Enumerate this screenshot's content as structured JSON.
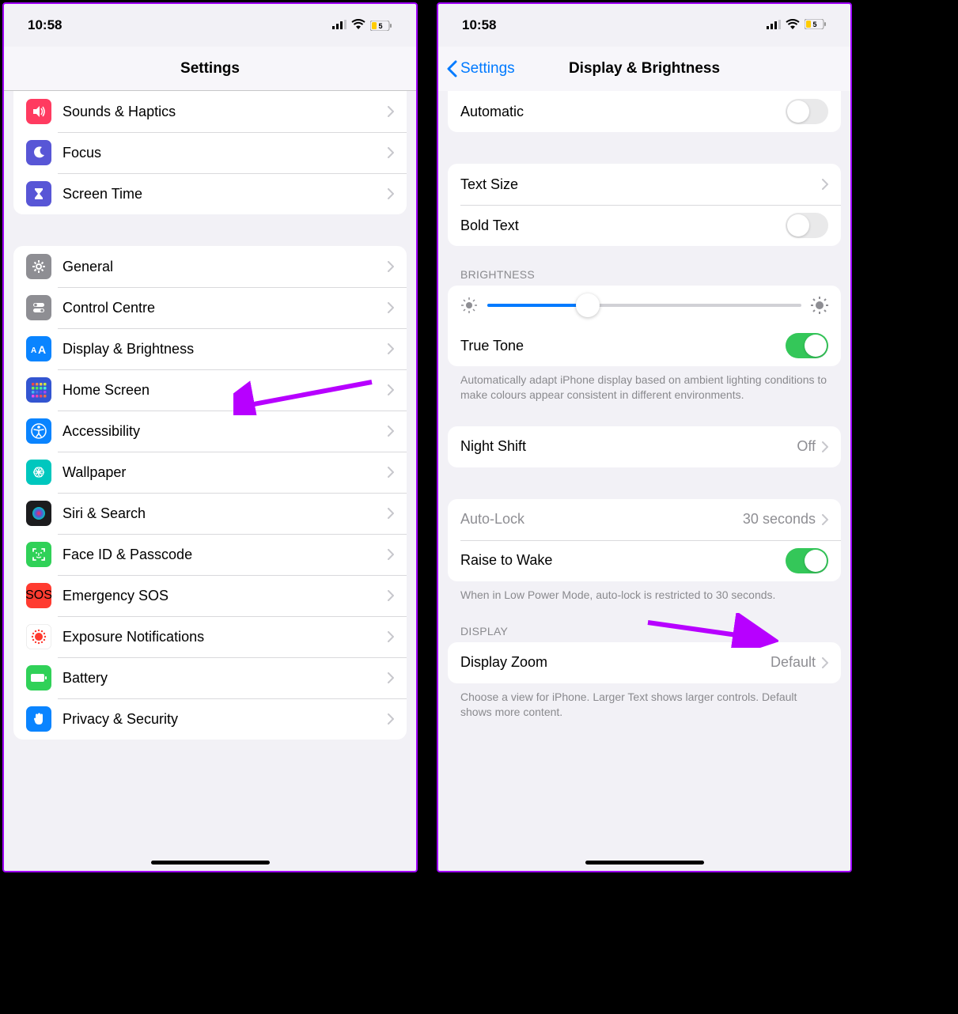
{
  "status": {
    "time": "10:58",
    "battery": "5"
  },
  "left": {
    "title": "Settings",
    "group1": [
      {
        "label": "Sounds & Haptics",
        "icon": "sound-icon",
        "bg": "#ff3b60"
      },
      {
        "label": "Focus",
        "icon": "moon-icon",
        "bg": "#5856d6"
      },
      {
        "label": "Screen Time",
        "icon": "hourglass-icon",
        "bg": "#5856d6"
      }
    ],
    "group2": [
      {
        "label": "General",
        "icon": "gear-icon",
        "bg": "#8e8e93"
      },
      {
        "label": "Control Centre",
        "icon": "toggles-icon",
        "bg": "#8e8e93"
      },
      {
        "label": "Display & Brightness",
        "icon": "aa-icon",
        "bg": "#0a84ff"
      },
      {
        "label": "Home Screen",
        "icon": "grid-icon",
        "bg": "#3355d1"
      },
      {
        "label": "Accessibility",
        "icon": "accessibility-icon",
        "bg": "#0a84ff"
      },
      {
        "label": "Wallpaper",
        "icon": "wallpaper-icon",
        "bg": "#00c7be"
      },
      {
        "label": "Siri & Search",
        "icon": "siri-icon",
        "bg": "#1c1c1e"
      },
      {
        "label": "Face ID & Passcode",
        "icon": "faceid-icon",
        "bg": "#30d158"
      },
      {
        "label": "Emergency SOS",
        "icon": "sos-icon",
        "bg": "#ff3b30"
      },
      {
        "label": "Exposure Notifications",
        "icon": "exposure-icon",
        "bg": "#ffffff"
      },
      {
        "label": "Battery",
        "icon": "battery-icon",
        "bg": "#30d158"
      },
      {
        "label": "Privacy & Security",
        "icon": "hand-icon",
        "bg": "#0a84ff"
      }
    ]
  },
  "right": {
    "back": "Settings",
    "title": "Display & Brightness",
    "automatic_label": "Automatic",
    "text_size_label": "Text Size",
    "bold_text_label": "Bold Text",
    "brightness_header": "BRIGHTNESS",
    "brightness_value_pct": 32,
    "true_tone_label": "True Tone",
    "true_tone_footer": "Automatically adapt iPhone display based on ambient lighting conditions to make colours appear consistent in different environments.",
    "night_shift_label": "Night Shift",
    "night_shift_value": "Off",
    "auto_lock_label": "Auto-Lock",
    "auto_lock_value": "30 seconds",
    "raise_to_wake_label": "Raise to Wake",
    "low_power_footer": "When in Low Power Mode, auto-lock is restricted to 30 seconds.",
    "display_header": "DISPLAY",
    "display_zoom_label": "Display Zoom",
    "display_zoom_value": "Default",
    "display_zoom_footer": "Choose a view for iPhone. Larger Text shows larger controls. Default shows more content."
  }
}
